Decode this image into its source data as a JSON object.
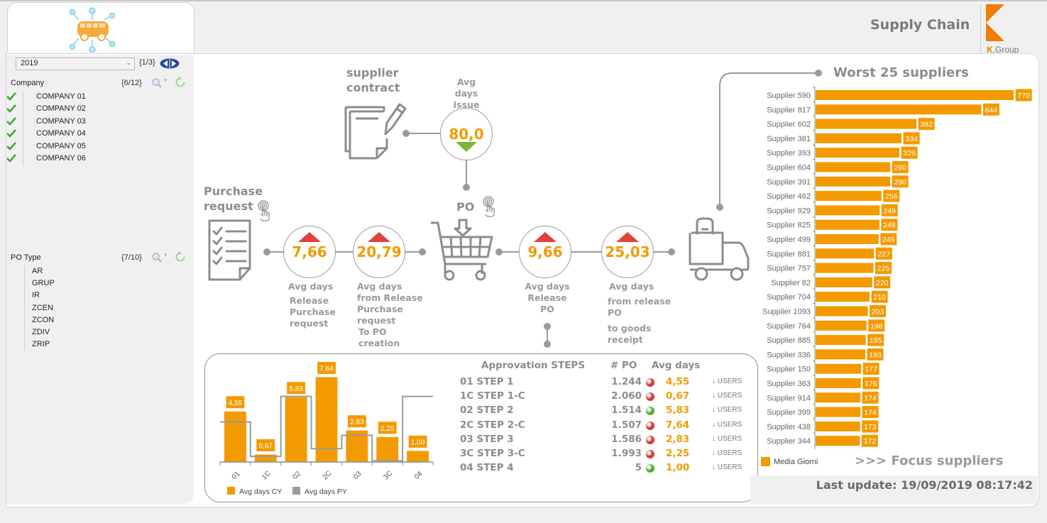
{
  "header": {
    "title": "Supply Chain",
    "brand_prefix": "K",
    "brand_suffix": ".Group"
  },
  "filters": {
    "year": {
      "selected": "2019",
      "page": "{1/3}"
    },
    "company": {
      "label": "Company",
      "count": "{6/12}",
      "items": [
        "COMPANY 01",
        "COMPANY 02",
        "COMPANY 03",
        "COMPANY 04",
        "COMPANY 05",
        "COMPANY 06"
      ]
    },
    "po_type": {
      "label": "PO Type",
      "count": "{7/10}",
      "items": [
        "AR",
        "GRUP",
        "IR",
        "ZCEN",
        "ZCON",
        "ZDIV",
        "ZRIP"
      ]
    }
  },
  "flow": {
    "supplier_contract": {
      "title_line1": "supplier",
      "title_line2": "contract"
    },
    "issue_po": {
      "cap_line1": "Avg days",
      "cap_line2": "Issue PO",
      "value": "80,0",
      "trend": "down"
    },
    "purchase_request": {
      "title_line1": "Purchase",
      "title_line2": "request"
    },
    "po_label": "PO",
    "kpis": [
      {
        "value": "7,66",
        "trend": "up",
        "caption": [
          "Avg days",
          "Release",
          "Purchase",
          "request"
        ]
      },
      {
        "value": "20,79",
        "trend": "up",
        "caption": [
          "Avg days",
          "from Release",
          "Purchase",
          "request",
          "To PO",
          "creation"
        ]
      },
      {
        "value": "9,66",
        "trend": "up",
        "caption": [
          "Avg days",
          "Release",
          "PO"
        ]
      },
      {
        "value": "25,03",
        "trend": "up",
        "caption": [
          "Avg days",
          "from release",
          "PO",
          "to goods",
          "receipt"
        ]
      }
    ]
  },
  "approval": {
    "headers": {
      "steps": "Approvation STEPS",
      "po": "# PO",
      "avg": "Avg days"
    },
    "rows": [
      {
        "step": "01 STEP 1",
        "po": "1.244",
        "status": "red",
        "avg": "4,55",
        "action": "↓ USERS"
      },
      {
        "step": "1C STEP 1-C",
        "po": "2.060",
        "status": "red",
        "avg": "0,67",
        "action": "↓ USERS"
      },
      {
        "step": "02 STEP 2",
        "po": "1.514",
        "status": "green",
        "avg": "5,83",
        "action": "↓ USERS"
      },
      {
        "step": "2C STEP 2-C",
        "po": "1.507",
        "status": "red",
        "avg": "7,64",
        "action": "↓ USERS"
      },
      {
        "step": "03 STEP 3",
        "po": "1.586",
        "status": "red",
        "avg": "2,83",
        "action": "↓ USERS"
      },
      {
        "step": "3C STEP 3-C",
        "po": "1.993",
        "status": "red",
        "avg": "2,25",
        "action": "↓ USERS"
      },
      {
        "step": "04 STEP 4",
        "po": "5",
        "status": "green",
        "avg": "1,00",
        "action": "↓ USERS"
      }
    ]
  },
  "colors": {
    "orange": "#f39a00",
    "gray": "#9a9a9a",
    "red": "#e2403c",
    "green": "#7ab631"
  },
  "chart_data": [
    {
      "type": "bar",
      "title": "",
      "categories": [
        "01",
        "1C",
        "02",
        "2C",
        "03",
        "3C",
        "04"
      ],
      "series": [
        {
          "name": "Avg days CY",
          "kind": "bar",
          "values": [
            4.55,
            0.67,
            5.83,
            7.64,
            2.83,
            2.25,
            1.0
          ],
          "labels": [
            "4,55",
            "0,67",
            "5,83",
            "7,64",
            "2,83",
            "2,25",
            "1,00"
          ]
        },
        {
          "name": "Avg days PY",
          "kind": "step-line",
          "values": [
            3.6,
            0.5,
            5.9,
            1.2,
            2.4,
            0.1,
            5.9
          ]
        }
      ],
      "ylim": [
        0,
        8.5
      ],
      "legend": "bottom-left",
      "grid": false
    },
    {
      "type": "bar",
      "orientation": "horizontal",
      "title": "Worst 25 suppliers",
      "categories": [
        "Supplier 590",
        "Supplier 817",
        "Supplier 602",
        "Supplier 381",
        "Supplier 393",
        "Supplier 604",
        "Supplier 391",
        "Supplier 462",
        "Supplier 929",
        "Supplier 825",
        "Supplier 499",
        "Supplier 881",
        "Supplier 757",
        "Supplier 82",
        "Supplier 704",
        "Supplier 1093",
        "Supplier 764",
        "Supplier 885",
        "Supplier 336",
        "Supplier 150",
        "Supplier 363",
        "Supplier 914",
        "Supplier 399",
        "Supplier 438",
        "Supplier 344"
      ],
      "series": [
        {
          "name": "Media Giorni",
          "values": [
            770,
            644,
            392,
            334,
            326,
            290,
            290,
            256,
            249,
            248,
            245,
            227,
            225,
            220,
            210,
            203,
            198,
            195,
            193,
            177,
            176,
            174,
            174,
            173,
            172
          ]
        }
      ],
      "xlim": [
        0,
        800
      ],
      "legend": "bottom-left",
      "grid": false
    }
  ],
  "footer": {
    "focus_link": ">>> Focus suppliers",
    "last_update": "Last update: 19/09/2019 08:17:42"
  }
}
